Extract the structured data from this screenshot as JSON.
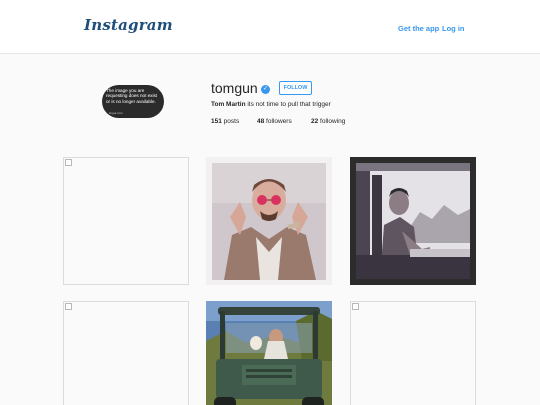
{
  "header": {
    "logo_text": "Instagram",
    "get_app_label": "Get the app",
    "login_label": "Log in"
  },
  "profile": {
    "avatar_message": "The image you are requesting does not exist or is no longer available.",
    "avatar_brand": "imgur.com",
    "username": "tomgun",
    "verified_icon": "verified-badge-icon",
    "follow_label": "FOLLOW",
    "full_name": "Tom Martin",
    "bio": "its not time to pull that trigger",
    "stats": {
      "posts_count": "151",
      "posts_label": "posts",
      "followers_count": "48",
      "followers_label": "followers",
      "following_count": "22",
      "following_label": "following"
    }
  },
  "colors": {
    "accent": "#3897f0",
    "logo": "#1d4f7a",
    "border": "#dbdbdb",
    "background": "#fafafa"
  }
}
